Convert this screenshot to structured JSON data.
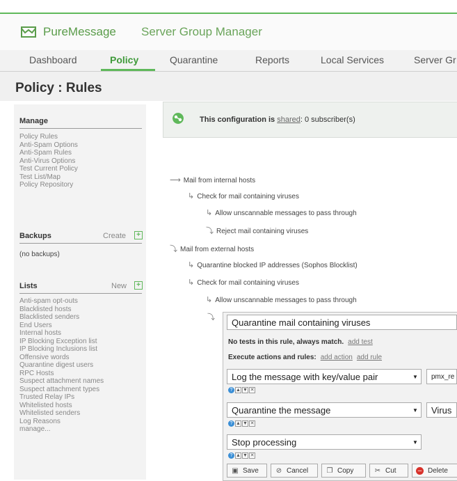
{
  "header": {
    "brand": "PureMessage",
    "product": "Server Group Manager"
  },
  "tabs": [
    "Dashboard",
    "Policy",
    "Quarantine",
    "Reports",
    "Local Services",
    "Server Gr"
  ],
  "active_tab": "Policy",
  "page_title": "Policy : Rules",
  "sidebar": {
    "manage": {
      "title": "Manage",
      "items": [
        "Policy Rules",
        "Anti-Spam Options",
        "Anti-Spam Rules",
        "Anti-Virus Options",
        "Test Current Policy",
        "Test List/Map",
        "Policy Repository"
      ]
    },
    "backups": {
      "title": "Backups",
      "action": "Create",
      "empty": "(no backups)"
    },
    "lists": {
      "title": "Lists",
      "action": "New",
      "items": [
        "Anti-spam opt-outs",
        "Blacklisted hosts",
        "Blacklisted senders",
        "End Users",
        "Internal hosts",
        "IP Blocking Exception list",
        "IP Blocking Inclusions list",
        "Offensive words",
        "Quarantine digest users",
        "RPC Hosts",
        "Suspect attachment names",
        "Suspect attachment types",
        "Trusted Relay IPs",
        "Whitelisted hosts",
        "Whitelisted senders",
        "Log Reasons",
        "manage..."
      ]
    }
  },
  "shared": {
    "prefix": "This configuration is ",
    "link": "shared",
    "suffix": ": 0 subscriber(s)"
  },
  "tree": [
    "Mail from internal hosts",
    "Check for mail containing viruses",
    "Allow unscannable messages to pass through",
    "Reject mail containing viruses",
    "Mail from external hosts",
    "Quarantine blocked IP addresses (Sophos Blocklist)",
    "Check for mail containing viruses",
    "Allow unscannable messages to pass through"
  ],
  "editor": {
    "rule_name": "Quarantine mail containing viruses",
    "tests_text": "No tests in this rule, always match.",
    "add_test": "add test",
    "exec_text": "Execute actions and rules:",
    "add_action": "add action",
    "add_rule": "add rule",
    "actions": [
      {
        "label": "Log the message with key/value pair",
        "param": "pmx_re"
      },
      {
        "label": "Quarantine the message",
        "param": "Virus"
      },
      {
        "label": "Stop processing",
        "param": ""
      }
    ],
    "buttons": [
      "Save",
      "Cancel",
      "Copy",
      "Cut",
      "Delete"
    ]
  },
  "colors": {
    "accent": "#5fb85a",
    "help": "#3b8fd6",
    "delete": "#d8322b"
  }
}
